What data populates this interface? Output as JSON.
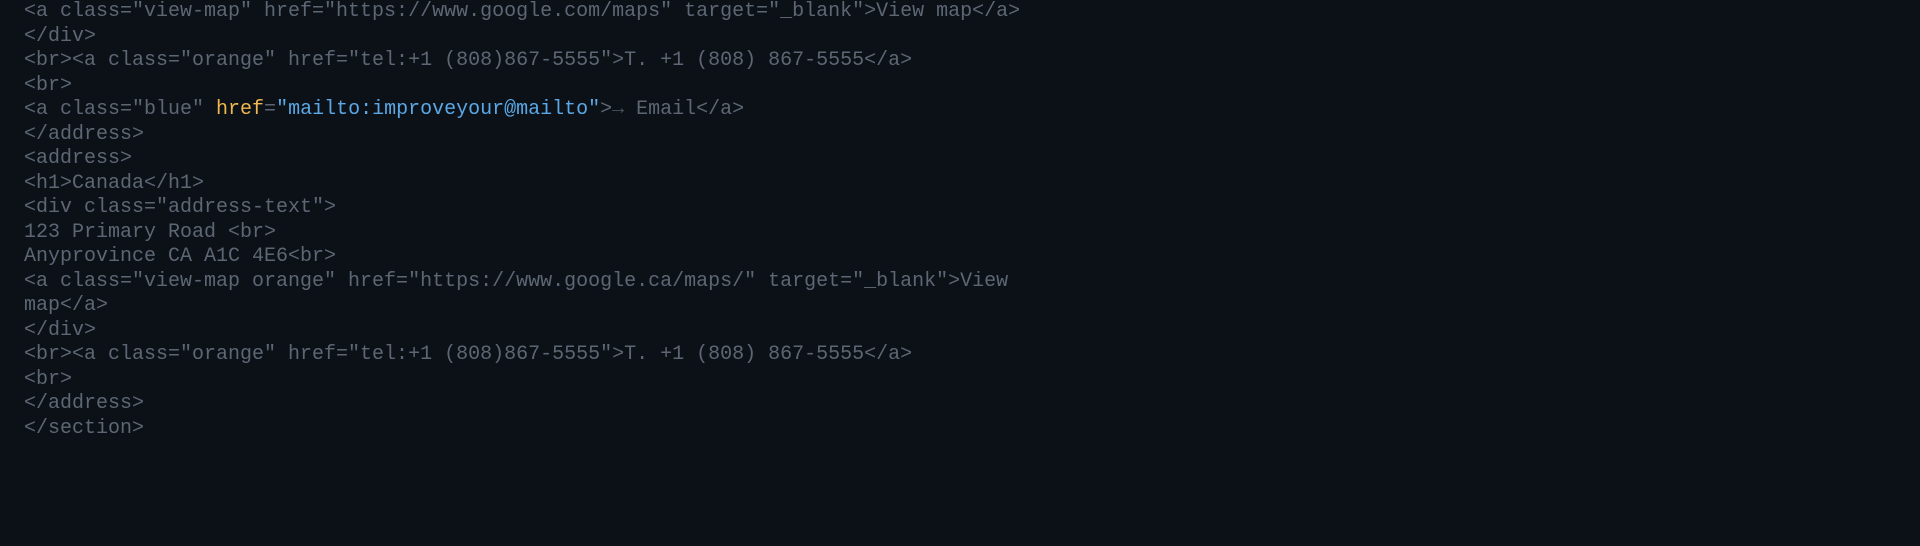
{
  "code": {
    "lines": [
      {
        "id": "l1",
        "segments": [
          {
            "cls": "token-dim",
            "text": "<a class=\"view-map\" href=\"https://www.google.com/maps\" target=\"_blank\">View map</a>"
          }
        ]
      },
      {
        "id": "l2",
        "segments": [
          {
            "cls": "token-dim",
            "text": "</div>"
          }
        ]
      },
      {
        "id": "l3",
        "segments": [
          {
            "cls": "token-dim",
            "text": "<br><a class=\"orange\" href=\"tel:+1 (808)867-5555\">T. +1 (808) 867-5555</a>"
          }
        ]
      },
      {
        "id": "l4",
        "segments": [
          {
            "cls": "token-dim",
            "text": "<br>"
          }
        ]
      },
      {
        "id": "l5",
        "segments": [
          {
            "cls": "token-dim",
            "text": "<a class=\"blue\" "
          },
          {
            "cls": "token-attr-name",
            "text": "href"
          },
          {
            "cls": "token-dim",
            "text": "="
          },
          {
            "cls": "token-attr-value",
            "text": "\"mailto:improveyour@mailto\""
          },
          {
            "cls": "token-dim",
            "text": ">"
          },
          {
            "cls": "token-arrow",
            "text": "→"
          },
          {
            "cls": "token-dim",
            "text": " Email</a>"
          }
        ]
      },
      {
        "id": "l6",
        "segments": [
          {
            "cls": "token-dim",
            "text": "</address>"
          }
        ]
      },
      {
        "id": "l7",
        "segments": [
          {
            "cls": "token-dim",
            "text": "<address>"
          }
        ]
      },
      {
        "id": "l8",
        "segments": [
          {
            "cls": "token-dim",
            "text": "<h1>Canada</h1>"
          }
        ]
      },
      {
        "id": "l9",
        "segments": [
          {
            "cls": "token-dim",
            "text": "<div class=\"address-text\">"
          }
        ]
      },
      {
        "id": "l10",
        "segments": [
          {
            "cls": "token-dim",
            "text": "123 Primary Road <br>"
          }
        ]
      },
      {
        "id": "l11",
        "segments": [
          {
            "cls": "token-dim",
            "text": "Anyprovince CA A1C 4E6<br>"
          }
        ]
      },
      {
        "id": "l12",
        "segments": [
          {
            "cls": "token-dim",
            "text": "<a class=\"view-map orange\" href=\"https://www.google.ca/maps/\" target=\"_blank\">View"
          }
        ]
      },
      {
        "id": "l13",
        "segments": [
          {
            "cls": "token-dim",
            "text": "map</a>"
          }
        ]
      },
      {
        "id": "l14",
        "segments": [
          {
            "cls": "token-dim",
            "text": "</div>"
          }
        ]
      },
      {
        "id": "l15",
        "segments": [
          {
            "cls": "token-dim",
            "text": "<br><a class=\"orange\" href=\"tel:+1 (808)867-5555\">T. +1 (808) 867-5555</a>"
          }
        ]
      },
      {
        "id": "l16",
        "segments": [
          {
            "cls": "token-dim",
            "text": "<br>"
          }
        ]
      },
      {
        "id": "l17",
        "segments": [
          {
            "cls": "token-dim",
            "text": "</address>"
          }
        ]
      },
      {
        "id": "l18",
        "segments": [
          {
            "cls": "token-dim",
            "text": "</section>"
          }
        ]
      }
    ]
  }
}
